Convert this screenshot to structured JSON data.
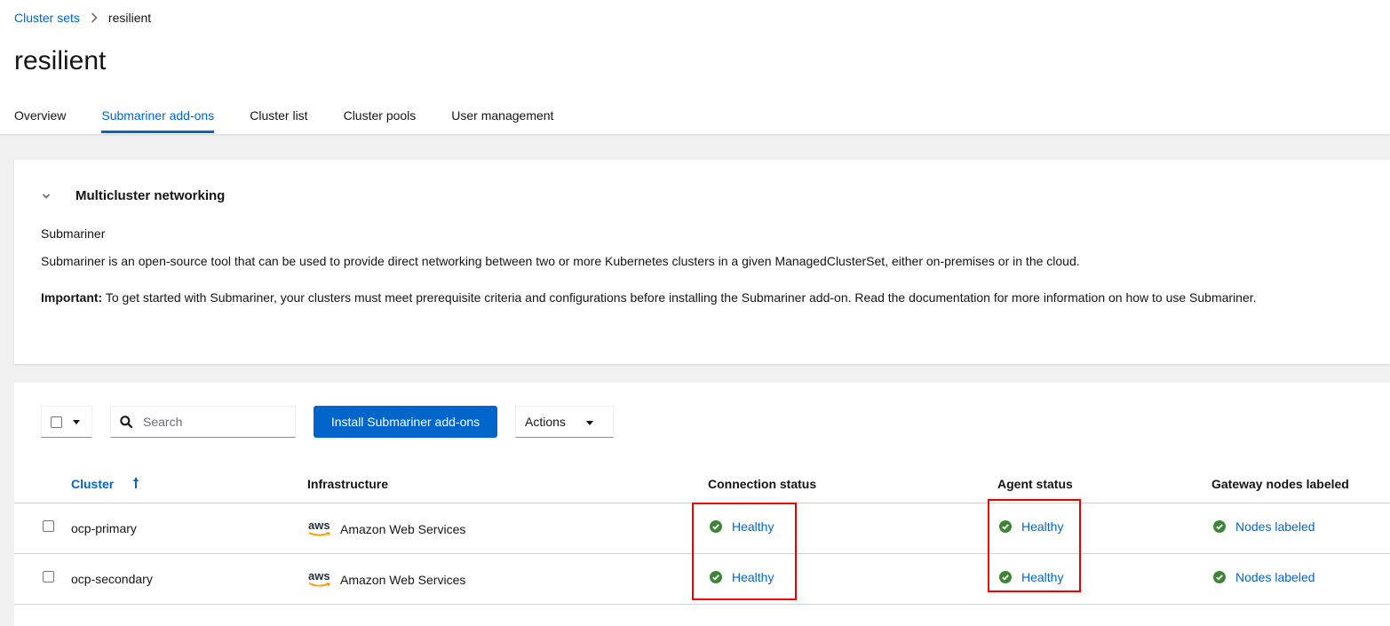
{
  "breadcrumb": {
    "parent": "Cluster sets",
    "current": "resilient"
  },
  "page": {
    "title": "resilient"
  },
  "tabs": [
    {
      "label": "Overview"
    },
    {
      "label": "Submariner add-ons",
      "active": true
    },
    {
      "label": "Cluster list"
    },
    {
      "label": "Cluster pools"
    },
    {
      "label": "User management"
    }
  ],
  "networking": {
    "title": "Multicluster networking",
    "subtitle": "Submariner",
    "description": "Submariner is an open-source tool that can be used to provide direct networking between two or more Kubernetes clusters in a given ManagedClusterSet, either on-premises or in the cloud.",
    "important_label": "Important:",
    "important_text": " To get started with Submariner, your clusters must meet prerequisite criteria and configurations before installing the Submariner add-on. Read the documentation for more information on how to use Submariner."
  },
  "toolbar": {
    "search_placeholder": "Search",
    "install_label": "Install Submariner add-ons",
    "actions_label": "Actions"
  },
  "table": {
    "headers": {
      "cluster": "Cluster",
      "infrastructure": "Infrastructure",
      "connection": "Connection status",
      "agent": "Agent status",
      "gateway": "Gateway nodes labeled"
    },
    "rows": [
      {
        "cluster": "ocp-primary",
        "infra_logo": "aws",
        "infrastructure": "Amazon Web Services",
        "connection": "Healthy",
        "agent": "Healthy",
        "gateway": "Nodes labeled"
      },
      {
        "cluster": "ocp-secondary",
        "infra_logo": "aws",
        "infrastructure": "Amazon Web Services",
        "connection": "Healthy",
        "agent": "Healthy",
        "gateway": "Nodes labeled"
      }
    ]
  },
  "icons": {
    "breadcrumb_sep": "chevron-right-icon",
    "expand": "chevron-down-icon",
    "search": "search-icon",
    "sort": "sort-asc-icon",
    "status": "check-circle-icon"
  },
  "colors": {
    "link": "#0066cc",
    "success": "#3e8635",
    "highlight": "#ee0000",
    "primary_button": "#0066cc"
  }
}
